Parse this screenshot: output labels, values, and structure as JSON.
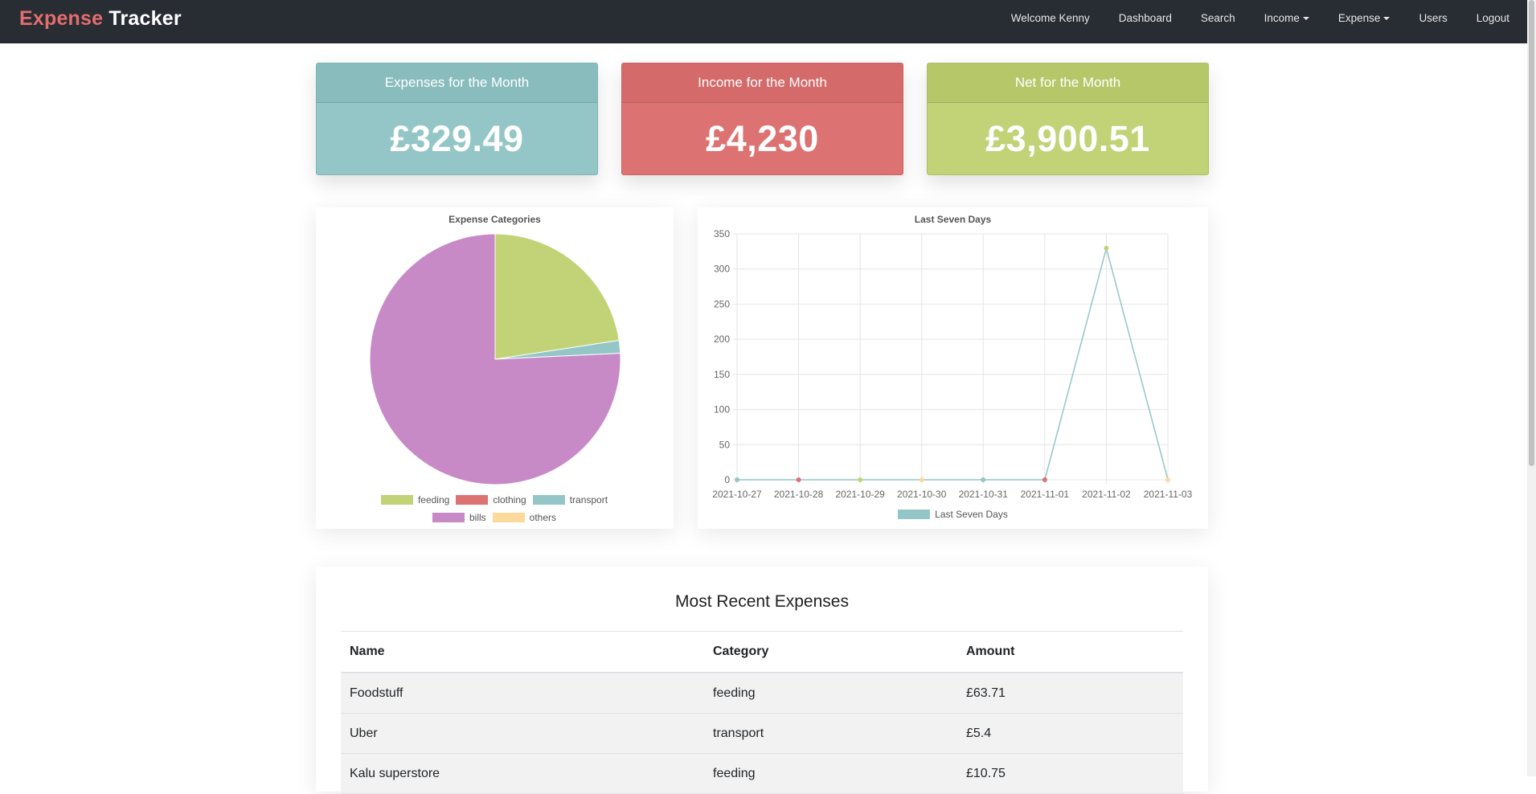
{
  "nav": {
    "brand_part1": "Expense",
    "brand_part2": "Tracker",
    "items": [
      "Welcome Kenny",
      "Dashboard",
      "Search",
      "Income",
      "Expense",
      "Users",
      "Logout"
    ]
  },
  "cards": {
    "expenses": {
      "title": "Expenses for the Month",
      "value": "£329.49",
      "color": "#94c6c7"
    },
    "income": {
      "title": "Income for the Month",
      "value": "£4,230",
      "color": "#dd7272"
    },
    "net": {
      "title": "Net for the Month",
      "value": "£3,900.51",
      "color": "#c2d276"
    }
  },
  "chart_data": [
    {
      "type": "pie",
      "title": "Expense Categories",
      "categories": [
        "feeding",
        "clothing",
        "transport",
        "bills",
        "others"
      ],
      "values": [
        74.46,
        0,
        5.4,
        249.63,
        0
      ],
      "colors": [
        "#c2d276",
        "#dd7272",
        "#94c6c7",
        "#c78ac6",
        "#fdd99c"
      ],
      "legend": "bottom"
    },
    {
      "type": "line",
      "title": "Last Seven Days",
      "x": [
        "2021-10-27",
        "2021-10-28",
        "2021-10-29",
        "2021-10-30",
        "2021-10-31",
        "2021-11-01",
        "2021-11-02",
        "2021-11-03"
      ],
      "series": [
        {
          "name": "Last Seven Days",
          "values": [
            0,
            0,
            0,
            0,
            0,
            0,
            329.49,
            0
          ],
          "color": "#94c6c7"
        }
      ],
      "point_colors": [
        "#94c6c7",
        "#dd7272",
        "#c2d276",
        "#fdd99c",
        "#94c6c7",
        "#dd7272",
        "#c2d276",
        "#fdd99c"
      ],
      "ylim": [
        0,
        350
      ],
      "yticks": [
        0,
        50,
        100,
        150,
        200,
        250,
        300,
        350
      ],
      "grid": true,
      "legend": "bottom"
    }
  ],
  "table": {
    "title": "Most Recent Expenses",
    "columns": [
      "Name",
      "Category",
      "Amount"
    ],
    "rows": [
      [
        "Foodstuff",
        "feeding",
        "£63.71"
      ],
      [
        "Uber",
        "transport",
        "£5.4"
      ],
      [
        "Kalu superstore",
        "feeding",
        "£10.75"
      ]
    ]
  }
}
